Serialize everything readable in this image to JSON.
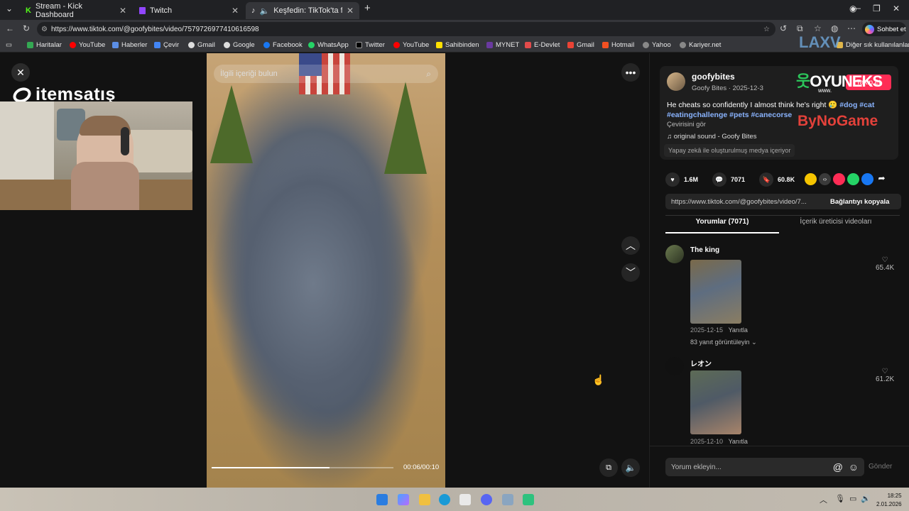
{
  "tabs": [
    {
      "label": "Stream - Kick Dashboard",
      "active": false
    },
    {
      "label": "Twitch",
      "active": false
    },
    {
      "label": "Keşfedin: TikTok'ta favori vide",
      "active": true
    }
  ],
  "address": {
    "url": "https://www.tiktok.com/@goofybites/video/7579726977410616598"
  },
  "sohbet_label": "Sohbet et",
  "bookmarks": [
    "Haritalar",
    "YouTube",
    "Haberler",
    "Çevir",
    "Gmail",
    "Google",
    "Facebook",
    "WhatsApp",
    "Twitter",
    "YouTube",
    "Sahibinden",
    "MYNET",
    "E-Devlet",
    "Gmail",
    "Hotmail",
    "Yahoo",
    "Kariyer.net"
  ],
  "other_favorites": "Diğer sık kullanılanlar",
  "overlay": {
    "brand": "itemsatış",
    "oyuneks": "OYUNEKS",
    "oyuneks_sub": "www.",
    "bynogame": "ByNoGame",
    "laxv": "LAXV"
  },
  "video": {
    "search_placeholder": "İlgili içeriği bulun",
    "timecode": "00:06/00:10",
    "progress": 0.65
  },
  "post": {
    "username": "goofybites",
    "display_name": "Goofy Bites",
    "date": "2025-12-3",
    "follow_label": "Takip et",
    "caption": "He cheats so confidently I almost think he's right",
    "hashtags": "#dog #cat #eatingchallenge #pets #canecorse",
    "translate": "Çevirisini gör",
    "sound": "original sound - Goofy Bites",
    "ai_notice": "Yapay zekâ ile oluşturulmuş medya içeriyor"
  },
  "stats": {
    "likes": "1.6M",
    "comments": "7071",
    "saves": "60.8K"
  },
  "link": {
    "url": "https://www.tiktok.com/@goofybites/video/7...",
    "copy_label": "Bağlantıyı kopyala"
  },
  "panel_tabs": [
    "Yorumlar (7071)",
    "İçerik üreticisi videoları"
  ],
  "comments": [
    {
      "user": "The king",
      "date": "2025-12-15",
      "reply": "Yanıtla",
      "likes": "65.4K",
      "replies": "83 yanıt görüntüleyin"
    },
    {
      "user": "レオン",
      "date": "2025-12-10",
      "reply": "Yanıtla",
      "likes": "61.2K"
    }
  ],
  "comment_input": {
    "placeholder": "Yorum ekleyin...",
    "send": "Gönder"
  },
  "clock": {
    "time": "18:25",
    "date": "2.01.2026"
  }
}
